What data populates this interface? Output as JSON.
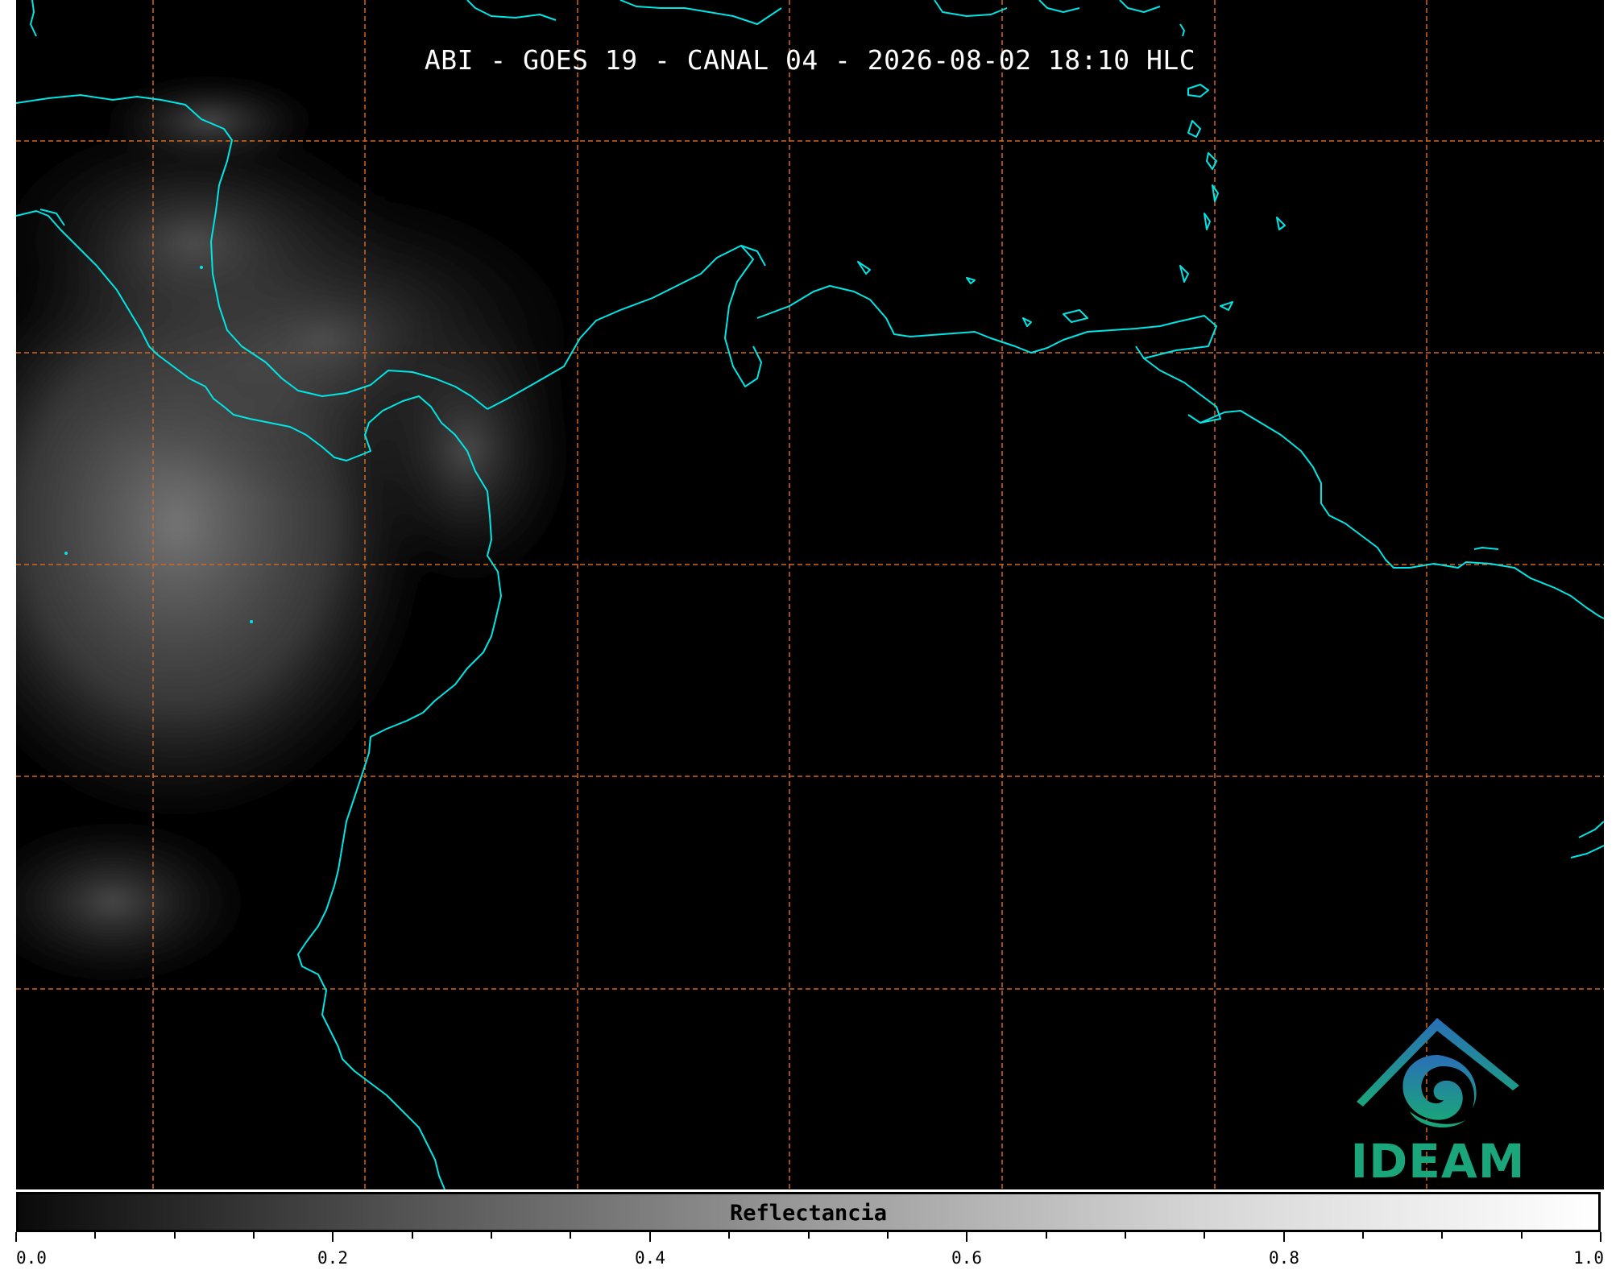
{
  "title": "ABI - GOES 19 - CANAL 04 - 2026-08-02 18:10 HLC",
  "colorbar": {
    "label": "Reflectancia",
    "min": 0.0,
    "max": 1.0,
    "tick_labels": [
      "0.0",
      "0.2",
      "0.4",
      "0.6",
      "0.8",
      "1.0"
    ],
    "colormap": "grayscale"
  },
  "logo": {
    "text": "IDEAM"
  },
  "colors": {
    "background": "#000000",
    "coastline": "#00e5e5",
    "gridline": "#d2691e",
    "logo_green": "#1aa57a",
    "logo_blue": "#2a7fb8"
  },
  "gridlines": {
    "style": "dashed",
    "count_vertical": 7,
    "count_horizontal": 5
  }
}
